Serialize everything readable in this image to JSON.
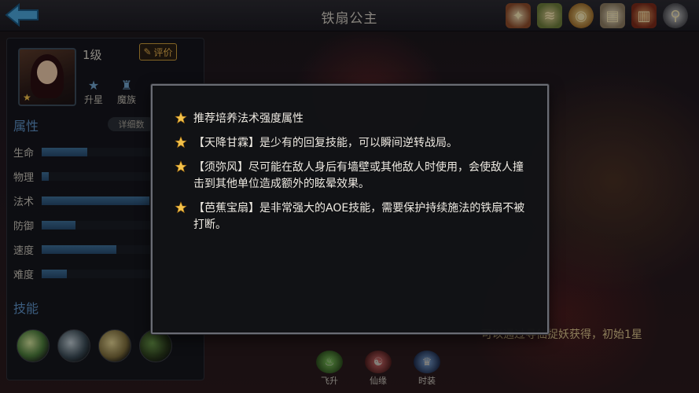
{
  "header": {
    "title": "铁扇公主",
    "icons": [
      "gift-icon",
      "scroll-icon",
      "coin-icon",
      "map-icon",
      "book-icon",
      "search-icon"
    ]
  },
  "hero": {
    "level": "1级",
    "rate_label": "评价",
    "buttons": [
      {
        "label": "升星",
        "icon": "star-icon"
      },
      {
        "label": "魔族",
        "icon": "clan-icon"
      }
    ],
    "attributes_title": "属性",
    "detail_label": "详细数",
    "stats": [
      {
        "name": "生命",
        "value": 0.4
      },
      {
        "name": "物理",
        "value": 0.06
      },
      {
        "name": "法术",
        "value": 0.95
      },
      {
        "name": "防御",
        "value": 0.3
      },
      {
        "name": "速度",
        "value": 0.66
      },
      {
        "name": "难度",
        "value": 0.22
      }
    ],
    "skills_title": "技能"
  },
  "bottom": {
    "tabs": [
      {
        "label": "飞升"
      },
      {
        "label": "仙缘"
      },
      {
        "label": "时装"
      }
    ],
    "hint": "可以通过寻仙捉妖获得，初始1星"
  },
  "modal": {
    "tips": [
      "推荐培养法术强度属性",
      "【天降甘霖】是少有的回复技能，可以瞬间逆转战局。",
      "【须弥风】尽可能在敌人身后有墙壁或其他敌人时使用，会使敌人撞击到其他单位造成额外的眩晕效果。",
      "【芭蕉宝扇】是非常强大的AOE技能，需要保护持续施法的铁扇不被打断。"
    ]
  },
  "colors": {
    "accent_blue": "#5c8fc4",
    "star_gold": "#f3c24b",
    "bar_blue": "#3d6d96"
  }
}
